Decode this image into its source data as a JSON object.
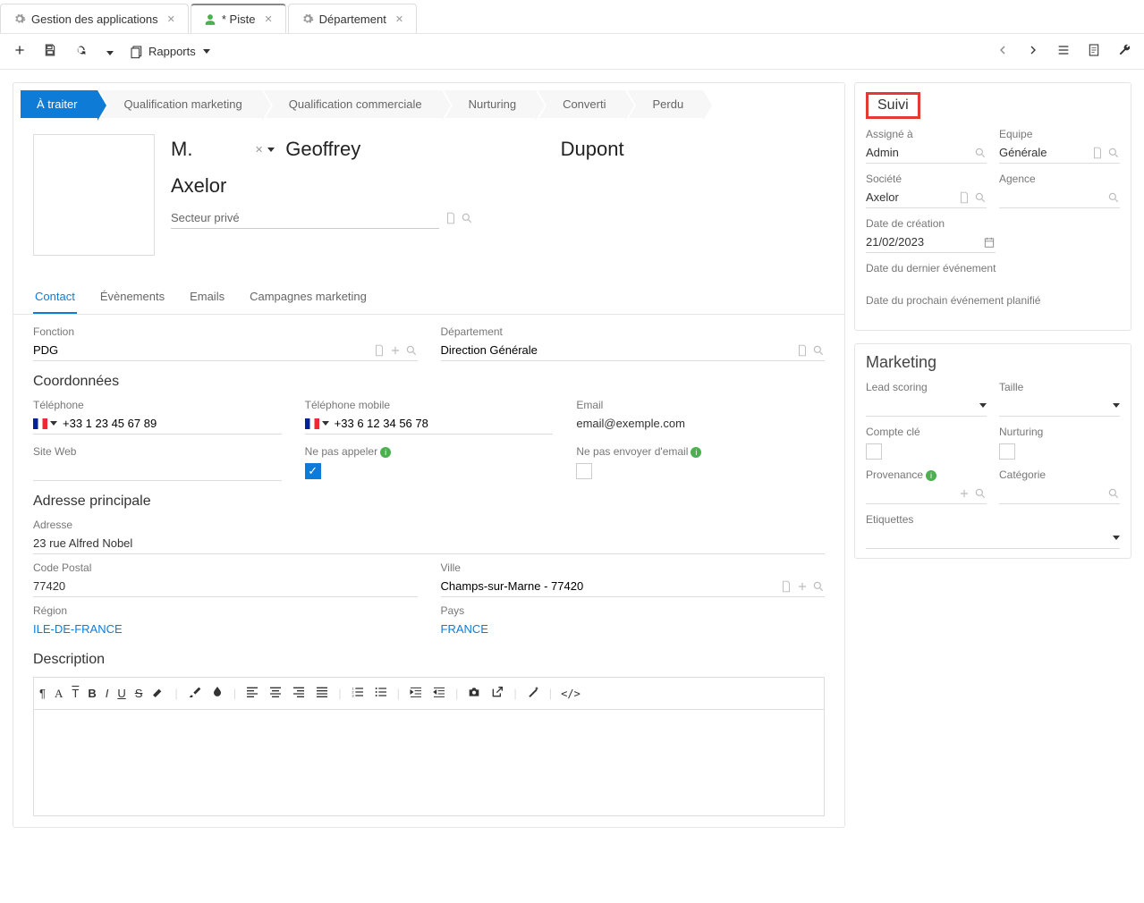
{
  "tabs": [
    {
      "label": "Gestion des applications",
      "icon": "gear",
      "active": false
    },
    {
      "label": "*  Piste",
      "icon": "user",
      "active": true
    },
    {
      "label": "Département",
      "icon": "gear",
      "active": false
    }
  ],
  "toolbar": {
    "reports": "Rapports"
  },
  "stages": [
    "À traiter",
    "Qualification marketing",
    "Qualification commerciale",
    "Nurturing",
    "Converti",
    "Perdu"
  ],
  "activeStage": 0,
  "lead": {
    "title": "M.",
    "first": "Geoffrey",
    "last": "Dupont",
    "company": "Axelor",
    "sector": "Secteur privé"
  },
  "subtabs": [
    "Contact",
    "Évènements",
    "Emails",
    "Campagnes marketing"
  ],
  "activeSubtab": 0,
  "labels": {
    "fonction": "Fonction",
    "departement": "Département",
    "coord": "Coordonnées",
    "tel": "Téléphone",
    "mob": "Téléphone mobile",
    "email": "Email",
    "web": "Site Web",
    "noCall": "Ne pas appeler",
    "noEmail": "Ne pas envoyer d'email",
    "addr": "Adresse principale",
    "adresse": "Adresse",
    "cp": "Code Postal",
    "ville": "Ville",
    "region": "Région",
    "pays": "Pays",
    "desc": "Description"
  },
  "values": {
    "fonction": "PDG",
    "departement": "Direction Générale",
    "tel": "+33 1 23 45 67 89",
    "mob": "+33 6 12 34 56 78",
    "email": "email@exemple.com",
    "web": "",
    "noCall": true,
    "noEmail": false,
    "adresse": "23 rue Alfred Nobel",
    "cp": "77420",
    "ville": "Champs-sur-Marne - 77420",
    "region": "ILE-DE-FRANCE",
    "pays": "FRANCE"
  },
  "suivi": {
    "title": "Suivi",
    "assigneLabel": "Assigné à",
    "assigne": "Admin",
    "equipeLabel": "Equipe",
    "equipe": "Générale",
    "societeLabel": "Société",
    "societe": "Axelor",
    "agenceLabel": "Agence",
    "agence": "",
    "dateCreationLabel": "Date de création",
    "dateCreation": "21/02/2023",
    "dateDernierLabel": "Date du dernier événement",
    "dateProchainLabel": "Date du prochain événement planifié"
  },
  "marketing": {
    "title": "Marketing",
    "leadScoringLabel": "Lead scoring",
    "tailleLabel": "Taille",
    "compteCleLabel": "Compte clé",
    "nurturingLabel": "Nurturing",
    "provenanceLabel": "Provenance",
    "categorieLabel": "Catégorie",
    "etiquettesLabel": "Etiquettes"
  }
}
